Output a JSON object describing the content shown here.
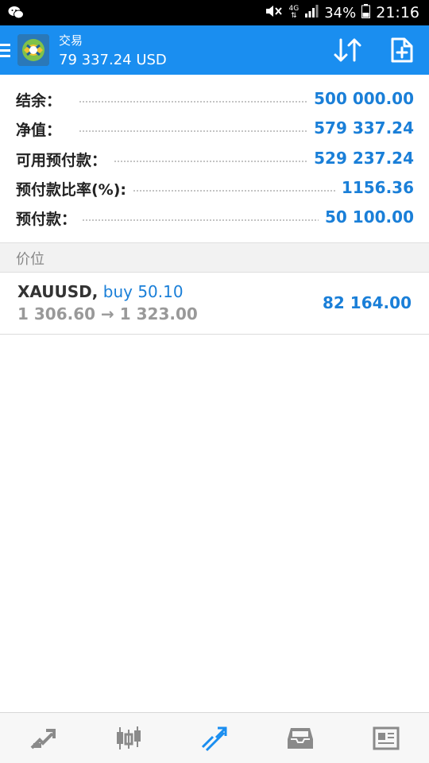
{
  "statusbar": {
    "battery_pct": "34%",
    "time": "21:16",
    "network": "4G"
  },
  "header": {
    "title": "交易",
    "balance_line": "79 337.24 USD",
    "color": "#1a8ef0"
  },
  "summary": [
    {
      "label": "结余：",
      "value": "500 000.00"
    },
    {
      "label": "净值：",
      "value": "579 337.24"
    },
    {
      "label": "可用预付款：",
      "value": "529 237.24"
    },
    {
      "label": "预付款比率(%):",
      "value": "1156.36"
    },
    {
      "label": "预付款：",
      "value": "50 100.00"
    }
  ],
  "section": {
    "title": "价位"
  },
  "position": {
    "symbol": "XAUUSD",
    "separator": ",",
    "type": "buy 50.10",
    "prices": "1 306.60 → 1 323.00",
    "profit": "82 164.00"
  },
  "nav": {
    "items": [
      {
        "icon": "quotes-icon"
      },
      {
        "icon": "chart-candles-icon"
      },
      {
        "icon": "trade-icon",
        "active": true
      },
      {
        "icon": "history-inbox-icon"
      },
      {
        "icon": "news-icon"
      }
    ],
    "active_color": "#1a8ef0",
    "inactive_color": "#8a8a8a"
  }
}
